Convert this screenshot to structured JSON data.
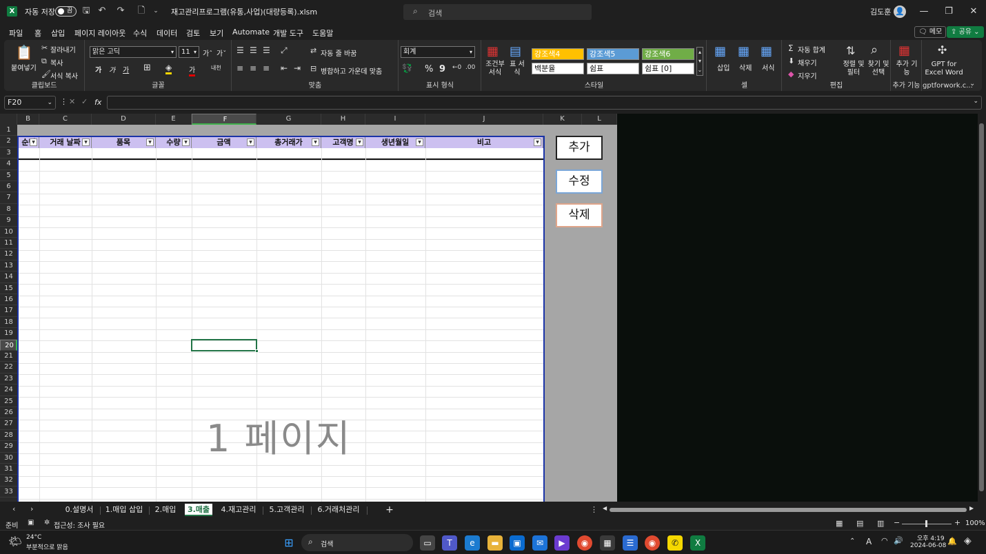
{
  "titlebar": {
    "autosave_label": "자동 저장",
    "autosave_state": "끔",
    "filename": "재고관리프로그램(유통,사업)(대량등록).xlsm",
    "search_placeholder": "검색",
    "user_name": "김도훈"
  },
  "menu": {
    "items": [
      "파일",
      "홈",
      "삽입",
      "페이지 레이아웃",
      "수식",
      "데이터",
      "검토",
      "보기",
      "Automate",
      "개발 도구",
      "도움말"
    ],
    "active": "홈",
    "memo_label": "메모",
    "share_label": "공유"
  },
  "ribbon": {
    "clipboard": {
      "paste": "붙여넣기",
      "cut": "잘라내기",
      "copy": "복사",
      "format_painter": "서식 복사",
      "label": "클립보드"
    },
    "font": {
      "name": "맑은 고딕",
      "size": "11",
      "grow": "가ˆ",
      "shrink": "가ˇ",
      "bold": "가",
      "italic": "가",
      "underline": "가",
      "color_a": "가",
      "phonetic": "내천",
      "label": "글꼴"
    },
    "alignment": {
      "wrap": "자동 줄 바꿈",
      "merge": "병합하고 가운데 맞춤",
      "label": "맞춤"
    },
    "number": {
      "format": "회계",
      "percent": "%",
      "comma": "9",
      "label": "표시 형식"
    },
    "styles": {
      "conditional": "조건부 서식",
      "table": "표 서식",
      "cells": [
        {
          "text": "강조색4",
          "bg": "#ffc000",
          "fg": "#ffffff"
        },
        {
          "text": "강조색5",
          "bg": "#5b9bd5",
          "fg": "#ffffff"
        },
        {
          "text": "강조색6",
          "bg": "#70ad47",
          "fg": "#ffffff"
        },
        {
          "text": "백분율",
          "bg": "#ffffff",
          "fg": "#111111"
        },
        {
          "text": "쉼표",
          "bg": "#ffffff",
          "fg": "#111111"
        },
        {
          "text": "쉼표 [0]",
          "bg": "#ffffff",
          "fg": "#111111"
        }
      ],
      "label": "스타일"
    },
    "cells_group": {
      "insert": "삽입",
      "delete": "삭제",
      "format": "서식",
      "label": "셀"
    },
    "editing": {
      "autosum": "자동 합계",
      "fill": "채우기",
      "clear": "지우기",
      "sort": "정렬 및 필터",
      "find": "찾기 및 선택",
      "label": "편집"
    },
    "addins": {
      "addins": "추가 기능",
      "gpt": "GPT for Excel Word",
      "label_addins": "추가 기능",
      "label_gpt": "gptforwork.c..."
    }
  },
  "formula_bar": {
    "name_box": "F20",
    "fx": "fx",
    "formula": ""
  },
  "grid": {
    "columns": [
      "B",
      "C",
      "D",
      "E",
      "F",
      "G",
      "H",
      "I",
      "J",
      "K",
      "L"
    ],
    "selected_column": "F",
    "rows": [
      "1",
      "2",
      "3",
      "4",
      "5",
      "6",
      "7",
      "8",
      "9",
      "10",
      "11",
      "12",
      "13",
      "14",
      "15",
      "16",
      "17",
      "18",
      "19",
      "20",
      "21",
      "22",
      "23",
      "24",
      "25",
      "26",
      "27",
      "28",
      "29",
      "30",
      "31",
      "32",
      "33"
    ],
    "selected_row": "20",
    "table_headers": [
      "순번",
      "거래 날짜",
      "품목",
      "수량",
      "금액",
      "총거래가",
      "고객명",
      "생년월일",
      "비고"
    ],
    "watermark": "1 페이지",
    "buttons": {
      "add": "추가",
      "edit": "수정",
      "delete": "삭제"
    }
  },
  "sheet_tabs": {
    "tabs": [
      "0.설명서",
      "1.매입 삽입",
      "2.매입",
      "3.매출",
      "4.재고관리",
      "5.고객관리",
      "6.거래처관리"
    ],
    "active": "3.매출",
    "add": "+"
  },
  "status": {
    "ready": "준비",
    "accessibility": "접근성: 조사 필요",
    "zoom": "100%"
  },
  "taskbar": {
    "weather_temp": "24°C",
    "weather_desc": "부분적으로 맑음",
    "search": "검색",
    "time": "오후 4:19",
    "date": "2024-06-08",
    "lang": "A"
  }
}
